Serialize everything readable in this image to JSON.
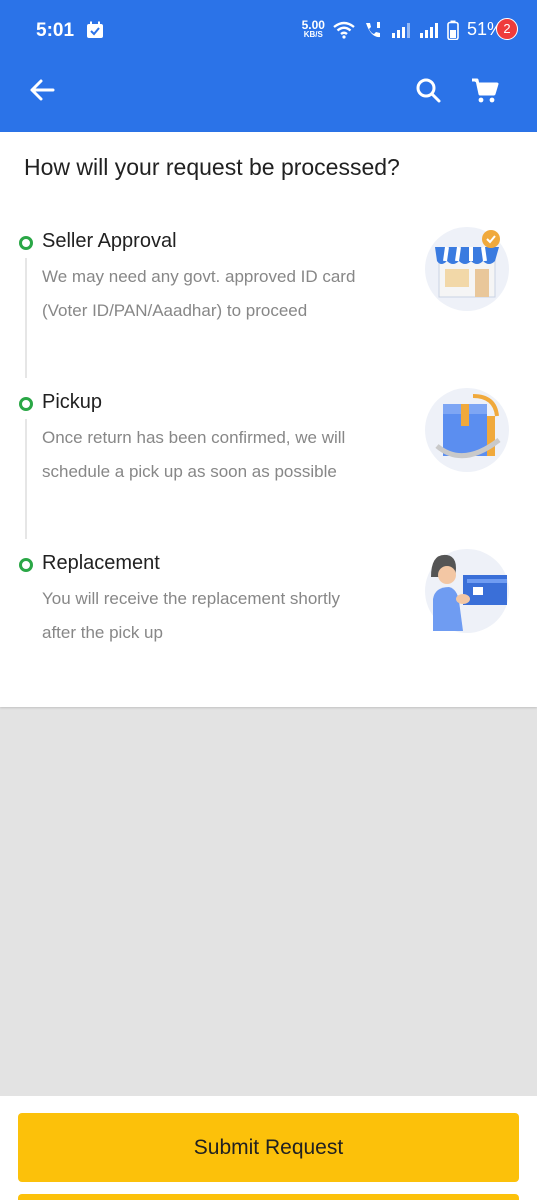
{
  "status_bar": {
    "time": "5:01",
    "speed_value": "5.00",
    "speed_unit": "KB/S",
    "battery": "51%"
  },
  "app_bar": {
    "cart_count": "2",
    "colors": {
      "bar": "#2b73e8",
      "badge": "#ef3b3b"
    }
  },
  "card": {
    "title": "How will your request be processed?"
  },
  "steps": [
    {
      "title": "Seller Approval",
      "desc_line1": "We may need any govt. approved ID card",
      "desc_line2": "(Voter ID/PAN/Aaadhar) to proceed",
      "icon": "store-icon"
    },
    {
      "title": "Pickup",
      "desc_line1": "Once return has been confirmed, we will",
      "desc_line2": "schedule a pick up as soon as possible",
      "icon": "package-icon"
    },
    {
      "title": "Replacement",
      "desc_line1": "You will receive the replacement shortly",
      "desc_line2": "after the pick up",
      "icon": "person-receiving-icon"
    }
  ],
  "footer": {
    "submit_label": "Submit Request",
    "button_color": "#fcc10a"
  },
  "accent_colors": {
    "step_dot": "#2aa746"
  }
}
